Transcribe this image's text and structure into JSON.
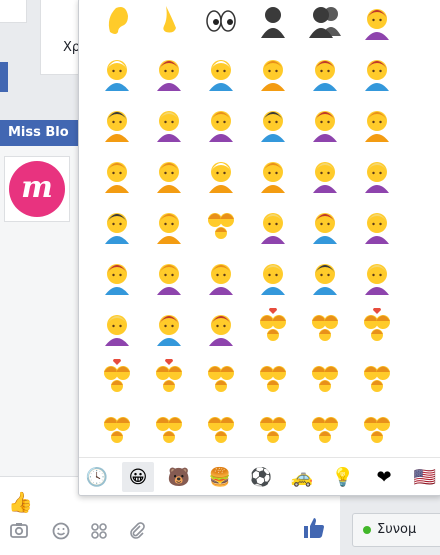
{
  "chat": {
    "partial_greeting": "Χρ",
    "title": "Miss Blo",
    "logo_letter": "m",
    "send_status": "Συνομ"
  },
  "colors": {
    "brand_blue": "#4267b2",
    "logo_pink": "#e8337f",
    "skin": "#ffcb2a",
    "online_green": "#42b72a"
  },
  "emoji_grid": {
    "rows": [
      [
        "ear-icon",
        "nose-icon",
        "eyes-icon",
        "bust-icon",
        "busts-icon",
        "baby-icon"
      ],
      [
        "boy-icon",
        "girl-icon",
        "man-icon",
        "woman-icon",
        "blond-man-icon",
        "older-man-icon"
      ],
      [
        "older-woman-icon",
        "cap-man-icon",
        "turban-man-icon",
        "police-icon",
        "construction-worker-icon",
        "guard-icon"
      ],
      [
        "santa-icon",
        "angel-icon",
        "princess-icon",
        "bride-icon",
        "walking-icon",
        "running-icon"
      ],
      [
        "dancer-icon",
        "bunny-icon",
        "couple-icon",
        "two-men-icon",
        "two-women-icon",
        "massage-icon"
      ],
      [
        "info-desk-icon",
        "no-gesture-icon",
        "ok-gesture-icon",
        "raising-hand-icon",
        "bowing-icon",
        "haircut-icon"
      ],
      [
        "pouting-icon",
        "face-mask-icon",
        "kiss-icon",
        "couple-heart-icon",
        "kiss-couple-icon",
        "couple-heart-2-icon"
      ],
      [
        "heart-couple-3-icon",
        "heart-couple-4-icon",
        "family-icon",
        "family-2-icon",
        "family-3-icon",
        "family-4-icon"
      ],
      [
        "family-5-icon",
        "family-6-icon",
        "family-7-icon",
        "family-8-icon",
        "family-9-icon",
        "family-10-icon"
      ]
    ]
  },
  "category_tabs": [
    {
      "icon": "clock-icon",
      "glyph": "🕓"
    },
    {
      "icon": "smiley-icon",
      "glyph": "😀"
    },
    {
      "icon": "bear-icon",
      "glyph": "🐻"
    },
    {
      "icon": "burger-icon",
      "glyph": "🍔"
    },
    {
      "icon": "soccer-ball-icon",
      "glyph": "⚽"
    },
    {
      "icon": "car-icon",
      "glyph": "🚕"
    },
    {
      "icon": "bulb-icon",
      "glyph": "💡"
    },
    {
      "icon": "heart-icon",
      "glyph": "❤"
    },
    {
      "icon": "flag-icon",
      "glyph": "🇺🇸"
    }
  ]
}
